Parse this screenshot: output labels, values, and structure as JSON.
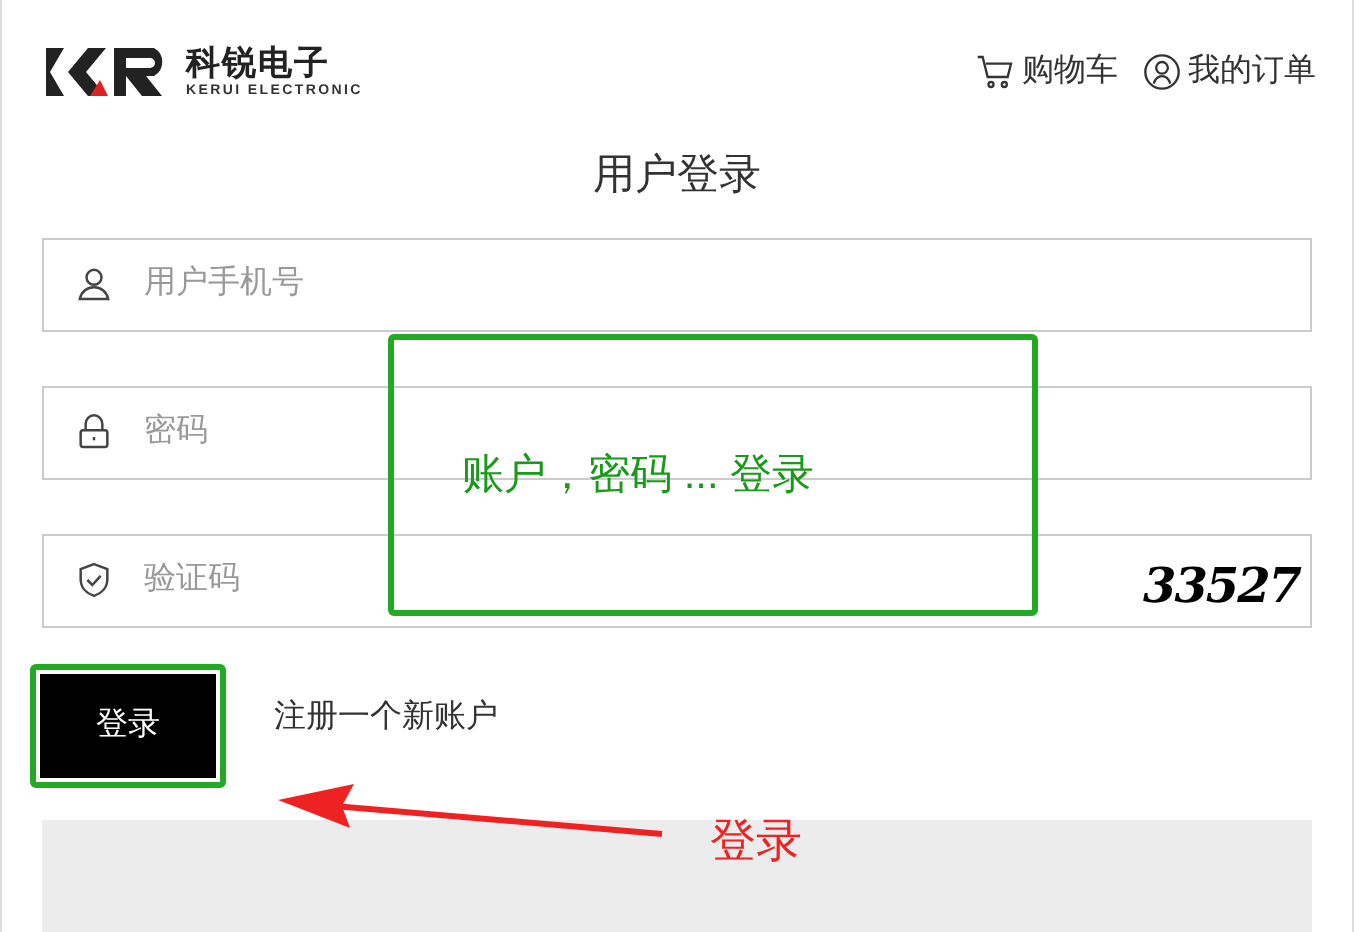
{
  "header": {
    "brand": {
      "name": "科锐电子",
      "subtitle": "KERUI ELECTRONIC"
    },
    "links": [
      {
        "kind": "cart",
        "label": "购物车"
      },
      {
        "kind": "user",
        "label": "我的订单"
      }
    ]
  },
  "title": "用户登录",
  "fields": [
    {
      "kind": "user",
      "placeholder": "用户手机号"
    },
    {
      "kind": "lock",
      "placeholder": "密码"
    },
    {
      "kind": "shield",
      "placeholder": "验证码",
      "captcha": "33527"
    }
  ],
  "login_button": "登录",
  "register_link": "注册一个新账户",
  "annotations": {
    "box_note": "账户，密码 ... 登录",
    "arrow_note": "登录"
  }
}
